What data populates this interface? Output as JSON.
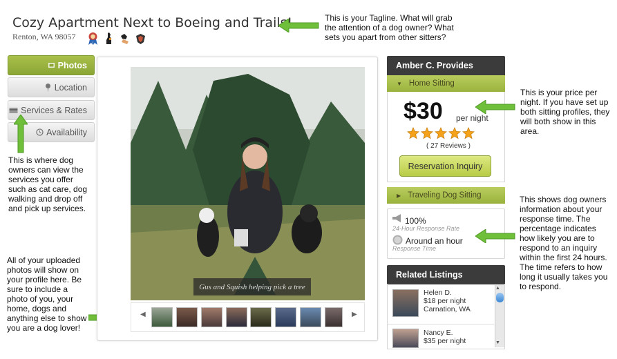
{
  "header": {
    "title": "Cozy Apartment Next to Boeing and Trails!",
    "location": "Renton, WA 98057",
    "badges": [
      "ribbon-badge-icon",
      "dog-badge-icon",
      "dog-hand-badge-icon",
      "shield-badge-icon"
    ]
  },
  "tabs": [
    {
      "label": "Photos",
      "icon": "photo-icon",
      "active": true
    },
    {
      "label": "Location",
      "icon": "map-pin-icon",
      "active": false
    },
    {
      "label": "Services & Rates",
      "icon": "card-icon",
      "active": false
    },
    {
      "label": "Availability",
      "icon": "clock-icon",
      "active": false
    }
  ],
  "photo": {
    "caption": "Gus and Squish helping pick a tree",
    "thumbnail_count": 8
  },
  "provides": {
    "heading": "Amber C. Provides",
    "home_sitting": "Home Sitting",
    "price": "$30",
    "per_night": "per night",
    "rating": 5,
    "reviews": "( 27 Reviews )",
    "reservation_button": "Reservation Inquiry",
    "traveling": "Traveling Dog Sitting"
  },
  "response": {
    "rate_value": "100%",
    "rate_label": "24-Hour Response Rate",
    "time_value": "Around an hour",
    "time_label": "Response Time"
  },
  "related": {
    "heading": "Related Listings",
    "listings": [
      {
        "name": "Helen D.",
        "price": "$18 per night",
        "city": "Carnation, WA"
      },
      {
        "name": "Nancy E.",
        "price": "$35 per night",
        "city": ""
      }
    ]
  },
  "notes": {
    "tagline": "This is your Tagline. What will grab the attention of a dog owner? What sets you apart from other sitters?",
    "price": "This is your price per night. If you have set up both sitting profiles, they will both show in this area.",
    "services": "This is where dog owners can view the services you offer such as cat care, dog walking and drop off and pick up services.",
    "response": "This shows dog owners information about your response time. The percentage indicates how likely you are to respond to an inquiry within the first 24 hours. The time refers to how long it usually takes you to respond.",
    "photos": "All of your uploaded photos will show on your profile here. Be sure to include a photo of you,  your home, dogs and anything else to show you are a dog lover!"
  },
  "colors": {
    "accent_green": "#9ab33d",
    "arrow_green": "#6fbf3a",
    "dark_header": "#3b3b3b",
    "star": "#f4a21a"
  }
}
